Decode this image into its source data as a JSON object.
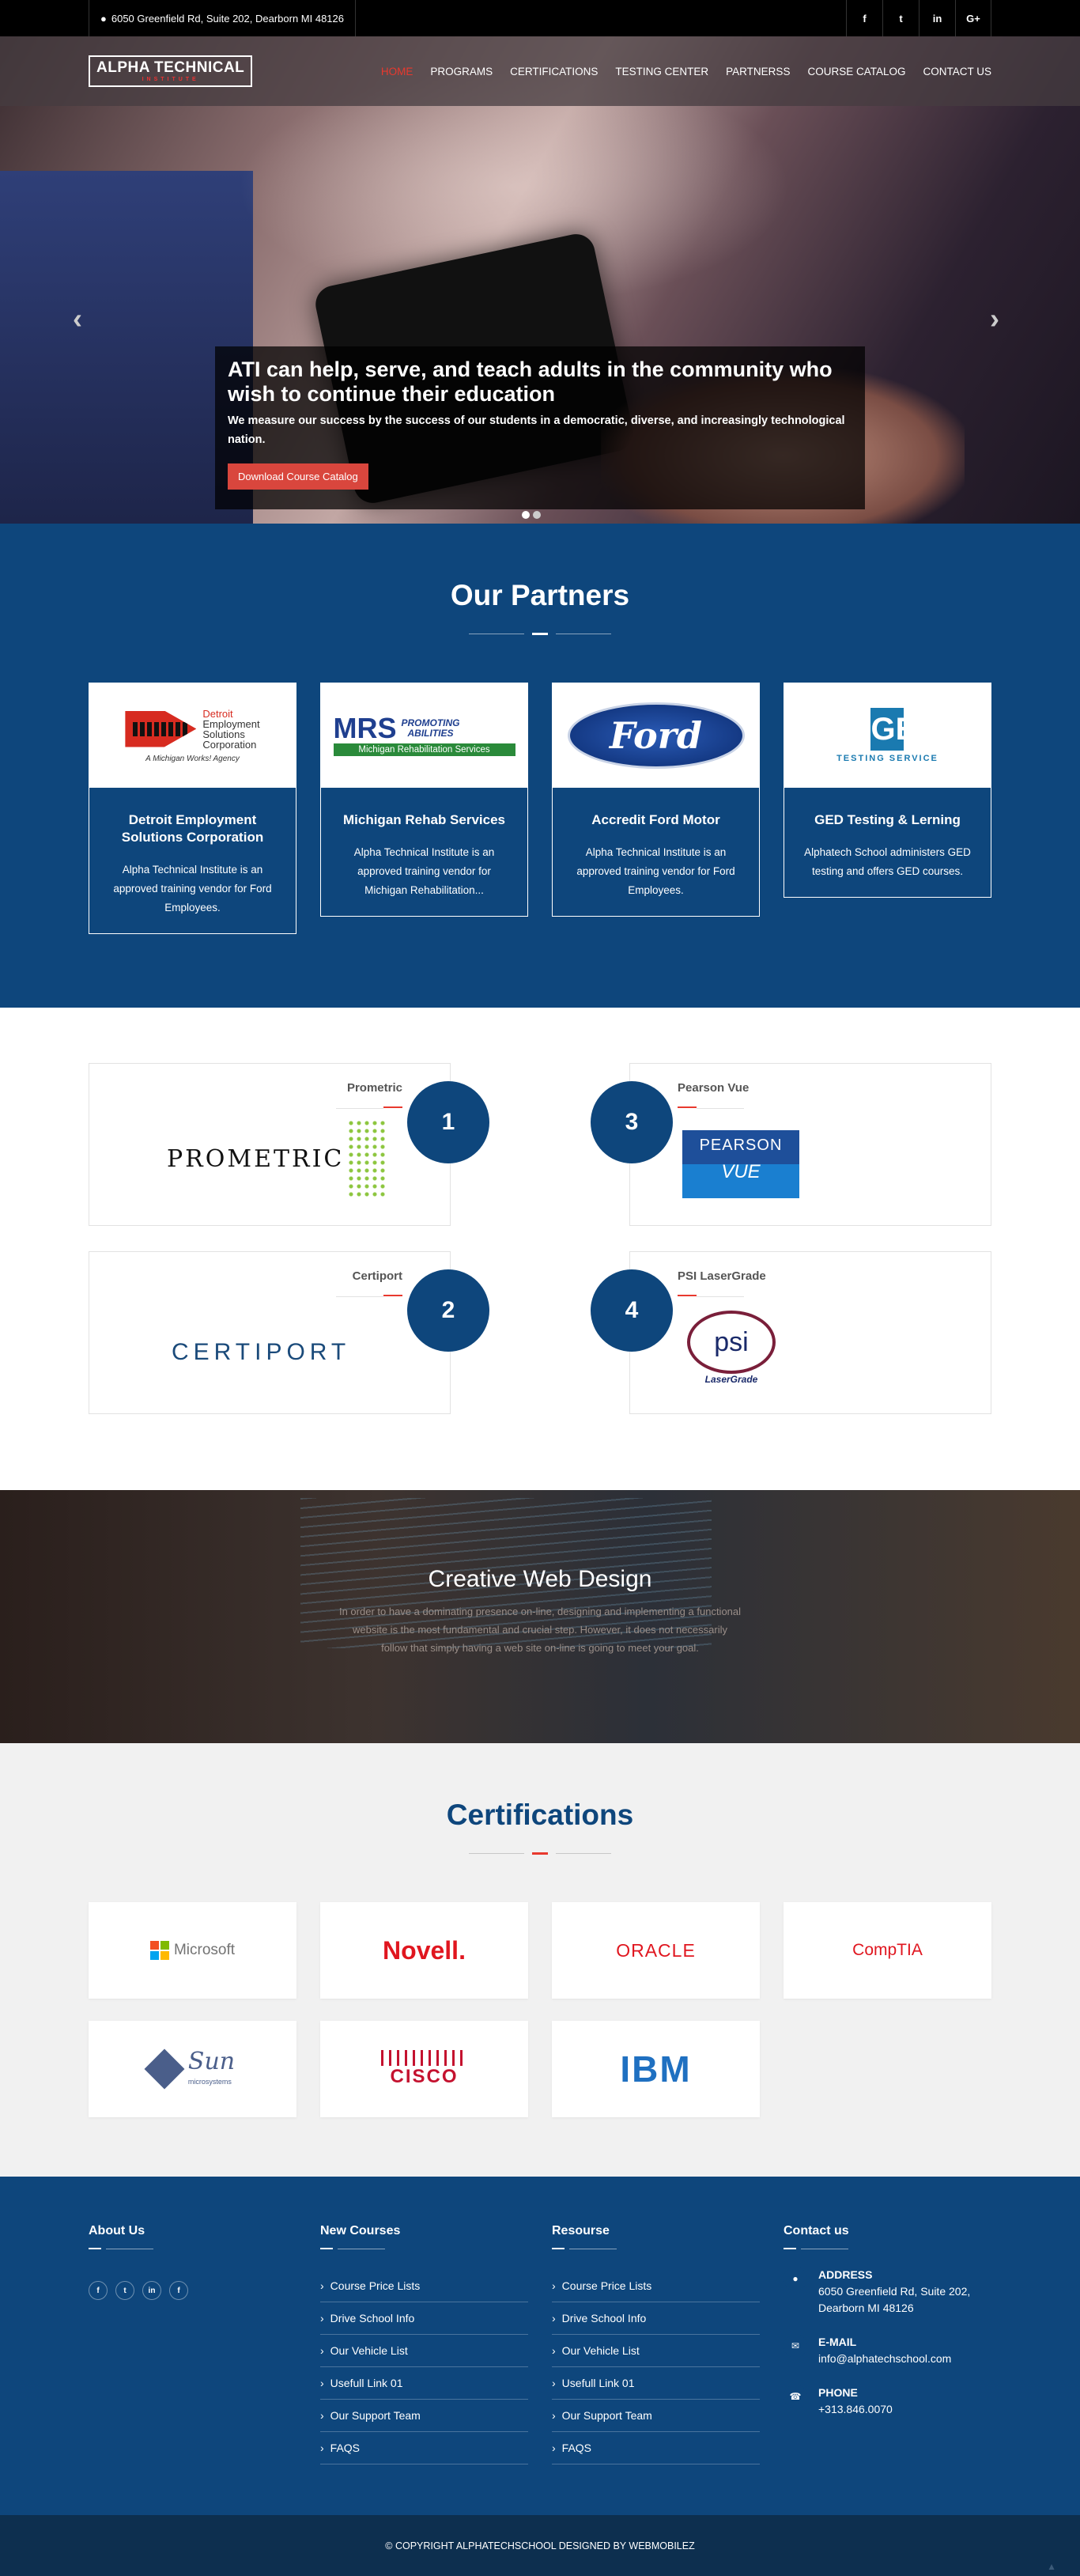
{
  "topbar": {
    "address": "6050 Greenfield Rd, Suite 202, Dearborn MI 48126",
    "socials": [
      "f",
      "t",
      "in",
      "G+"
    ]
  },
  "nav": {
    "logo": "ALPHA TECHNICAL",
    "logo_sub": "INSTITUTE",
    "items": [
      "Home",
      "Programs",
      "Certifications",
      "Testing Center",
      "Partnerss",
      "Course Catalog",
      "Contact Us"
    ]
  },
  "hero": {
    "title": "ATI can help, serve, and teach adults in the community who wish to continue their education",
    "text": "We measure our success by the success of our students in a democratic, diverse, and increasingly technological nation.",
    "button": "Download Course Catalog"
  },
  "partners": {
    "title": "Our Partners",
    "cards": [
      {
        "name": "Detroit Employment Solutions Corporation",
        "text": "Alpha Technical Institute is an approved training vendor for Ford Employees.",
        "logo_line1": "Detroit",
        "logo_line2": "Employment",
        "logo_line3": "Solutions",
        "logo_line4": "Corporation",
        "logo_tag": "A Michigan Works! Agency"
      },
      {
        "name": "Michigan Rehab Services",
        "text": "Alpha Technical Institute is an approved training vendor for Michigan Rehabilitation...",
        "logo_main": "MRS",
        "logo_side1": "PROMOTING",
        "logo_side2": "ABILITIES",
        "logo_bar": "Michigan Rehabilitation Services"
      },
      {
        "name": "Accredit Ford Motor",
        "text": "Alpha Technical Institute is an approved training vendor for Ford Employees.",
        "logo_main": "Ford"
      },
      {
        "name": "GED Testing & Lerning",
        "text": "Alphatech School administers GED testing and offers GED courses.",
        "logo_main": "GED",
        "logo_sub": "TESTING SERVICE"
      }
    ]
  },
  "vendors": [
    {
      "name": "Prometric",
      "num": "1",
      "logo": "PROMETRIC"
    },
    {
      "name": "Pearson Vue",
      "num": "3",
      "logo_1": "PEARSON",
      "logo_2": "VUE"
    },
    {
      "name": "Certiport",
      "num": "2",
      "logo": "CERTIPORT"
    },
    {
      "name": "PSI LaserGrade",
      "num": "4",
      "logo_1": "psi",
      "logo_2": "LaserGrade"
    }
  ],
  "creative": {
    "title": "Creative Web Design",
    "text": "In order to have a dominating presence on-line, designing and implementing a functional website is the most fundamental and crucial step. However, it does not necessarily follow that simply having a web site on-line is going to meet your goal."
  },
  "certs": {
    "title": "Certifications",
    "logos": [
      "Microsoft",
      "Novell.",
      "ORACLE",
      "CompTIA",
      "Sun",
      "CISCO",
      "IBM"
    ],
    "sun_sub": "microsystems"
  },
  "footer": {
    "about": {
      "title": "About Us",
      "socials": [
        "f",
        "t",
        "in",
        "f"
      ]
    },
    "new_courses": {
      "title": "New Courses",
      "links": [
        "Course Price Lists",
        "Drive School Info",
        "Our Vehicle List",
        "Usefull Link 01",
        "Our Support Team",
        "FAQS"
      ]
    },
    "resource": {
      "title": "Resourse",
      "links": [
        "Course Price Lists",
        "Drive School Info",
        "Our Vehicle List",
        "Usefull Link 01",
        "Our Support Team",
        "FAQS"
      ]
    },
    "contact": {
      "title": "Contact us",
      "address_label": "Address",
      "address": "6050 Greenfield Rd, Suite 202, Dearborn MI 48126",
      "email_label": "E-mail",
      "email": "info@alphatechschool.com",
      "phone_label": "Phone",
      "phone": "+313.846.0070"
    }
  },
  "copyright": "© COPYRIGHT ALPHATECHSCHOOL DESIGNED BY WEBMOBILEZ",
  "colors": {
    "primary": "#0e467c",
    "accent": "#e8392e",
    "dark": "#0d2f4f"
  }
}
